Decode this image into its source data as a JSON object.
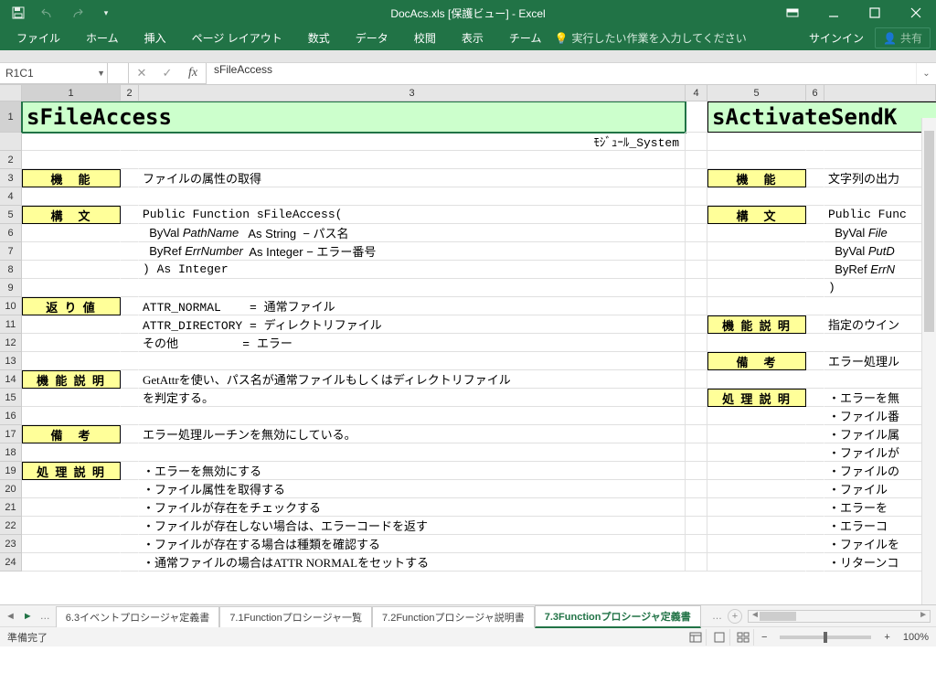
{
  "titlebar": {
    "title": "DocAcs.xls  [保護ビュー] - Excel"
  },
  "ribbon": {
    "tabs": [
      "ファイル",
      "ホーム",
      "挿入",
      "ページ レイアウト",
      "数式",
      "データ",
      "校閲",
      "表示",
      "チーム"
    ],
    "tell_me": "実行したい作業を入力してください",
    "signin": "サインイン",
    "share": "共有"
  },
  "formula": {
    "name_box": "R1C1",
    "value": "sFileAccess"
  },
  "columns": [
    "1",
    "2",
    "3",
    "4",
    "5",
    "6"
  ],
  "sheet": {
    "title_left": "sFileAccess",
    "title_right": "sActivateSendK",
    "module": "ﾓｼﾞｭｰﾙ_System",
    "labels": {
      "kinou": "機　能",
      "koubun": "構　文",
      "kaeri": "返 り 値",
      "kinou_setsumei": "機 能 説 明",
      "bikou": "備　考",
      "shori_setsumei": "処 理 説 明"
    },
    "left": {
      "r3": "ファイルの属性の取得",
      "r5": "Public Function sFileAccess(",
      "r6a": "  ByVal ",
      "r6b": "PathName",
      "r6c": "   As String  − パス名",
      "r7a": "  ByRef ",
      "r7b": "ErrNumber",
      "r7c": "  As Integer − エラー番号",
      "r8": ") As Integer",
      "r10": "ATTR_NORMAL    = 通常ファイル",
      "r11": "ATTR_DIRECTORY = ディレクトリファイル",
      "r12": "その他         = エラー",
      "r14": "GetAttrを使い、パス名が通常ファイルもしくはディレクトリファイル",
      "r15": "を判定する。",
      "r17": "エラー処理ルーチンを無効にしている。",
      "r19": "・エラーを無効にする",
      "r20": "・ファイル属性を取得する",
      "r21": "・ファイルが存在をチェックする",
      "r22": "  ・ファイルが存在しない場合は、エラーコードを返す",
      "r23": "・ファイルが存在する場合は種類を確認する",
      "r24": "  ・通常ファイルの場合はATTR NORMALをセットする"
    },
    "right": {
      "r3": "文字列の出力",
      "r5": "Public Func",
      "r6a": "  ByVal ",
      "r6b": "File",
      "r7a": "  ByVal ",
      "r7b": "PutD",
      "r8a": "  ByRef ",
      "r8b": "ErrN",
      "r9": ")",
      "r11": "指定のウイン",
      "r13": "エラー処理ル",
      "r15": "・エラーを無",
      "r16": "・ファイル番",
      "r17": "・ファイル属",
      "r18": "・ファイルが",
      "r19": "・ファイルの",
      "r20": "  ・ファイル",
      "r21": "  ・エラーを",
      "r22": "  ・エラーコ",
      "r23": "・ファイルを",
      "r24": "・リターンコ"
    }
  },
  "tabs": {
    "t1": "6.3イベントプロシージャ定義書",
    "t2": "7.1Functionプロシージャ一覧",
    "t3": "7.2Functionプロシージャ説明書",
    "t4": "7.3Functionプロシージャ定義書"
  },
  "status": {
    "ready": "準備完了",
    "zoom": "100%"
  }
}
